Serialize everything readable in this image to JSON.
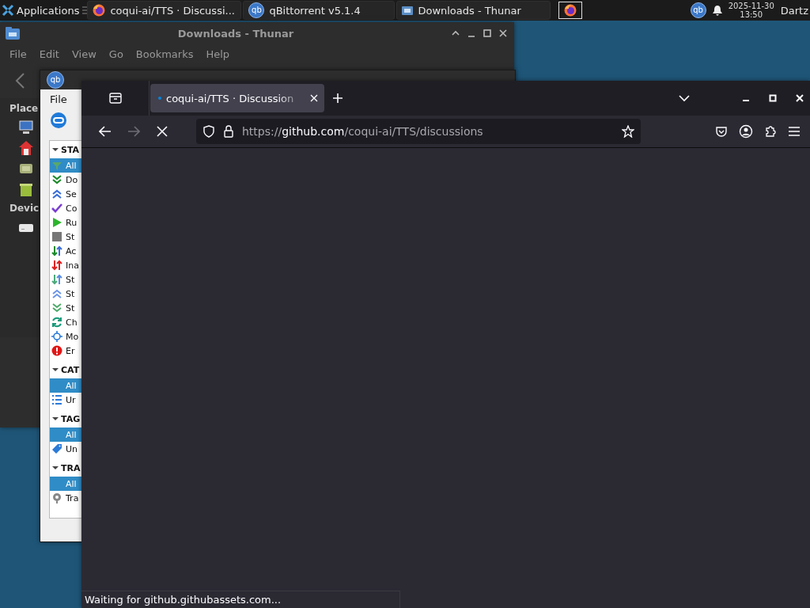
{
  "taskbar": {
    "apps_label": "Applications",
    "tasks": [
      {
        "kind": "firefox",
        "label": "coqui-ai/TTS · Discussi...",
        "selected": false
      },
      {
        "kind": "qbittorrent",
        "label": "qBittorrent v5.1.4",
        "icon_text": "qb",
        "selected": false
      },
      {
        "kind": "thunar",
        "label": "Downloads - Thunar",
        "selected": false
      }
    ],
    "launcher": {
      "kind": "firefox",
      "selected": true
    },
    "tray": {
      "qb_icon_text": "qb",
      "date": "2025-11-30",
      "time": "13:50",
      "user": "Dartz"
    }
  },
  "thunar": {
    "title": "Downloads - Thunar",
    "menu": [
      "File",
      "Edit",
      "View",
      "Go",
      "Bookmarks",
      "Help"
    ],
    "sidebar": {
      "places_heading": "Place",
      "devices_heading": "Devic"
    }
  },
  "qbittorrent": {
    "icon_text": "qb",
    "menu": [
      "File"
    ],
    "sections": [
      {
        "heading": "STA",
        "items": [
          {
            "label": "All",
            "selected": true
          },
          {
            "label": "Do",
            "selected": false
          },
          {
            "label": "Se",
            "selected": false
          },
          {
            "label": "Co",
            "selected": false
          },
          {
            "label": "Ru",
            "selected": false
          },
          {
            "label": "St",
            "selected": false
          },
          {
            "label": "Ac",
            "selected": false
          },
          {
            "label": "Ina",
            "selected": false
          },
          {
            "label": "St",
            "selected": false
          },
          {
            "label": "St",
            "selected": false
          },
          {
            "label": "St",
            "selected": false
          },
          {
            "label": "Ch",
            "selected": false
          },
          {
            "label": "Mo",
            "selected": false
          },
          {
            "label": "Er",
            "selected": false
          }
        ]
      },
      {
        "heading": "CAT",
        "items": [
          {
            "label": "All",
            "selected": true
          },
          {
            "label": "Ur",
            "selected": false
          }
        ]
      },
      {
        "heading": "TAG",
        "items": [
          {
            "label": "All",
            "selected": true
          },
          {
            "label": "Un",
            "selected": false
          }
        ]
      },
      {
        "heading": "TRA",
        "items": [
          {
            "label": "All",
            "selected": true
          },
          {
            "label": "Tra",
            "selected": false
          }
        ]
      }
    ]
  },
  "firefox": {
    "tab": {
      "title": "coqui-ai/TTS · Discussion",
      "loading": true,
      "selected": true
    },
    "url": "https://github.com/coqui-ai/TTS/discussions",
    "forward_disabled": true,
    "loading": true,
    "status": "Waiting for github.githubassets.com..."
  }
}
